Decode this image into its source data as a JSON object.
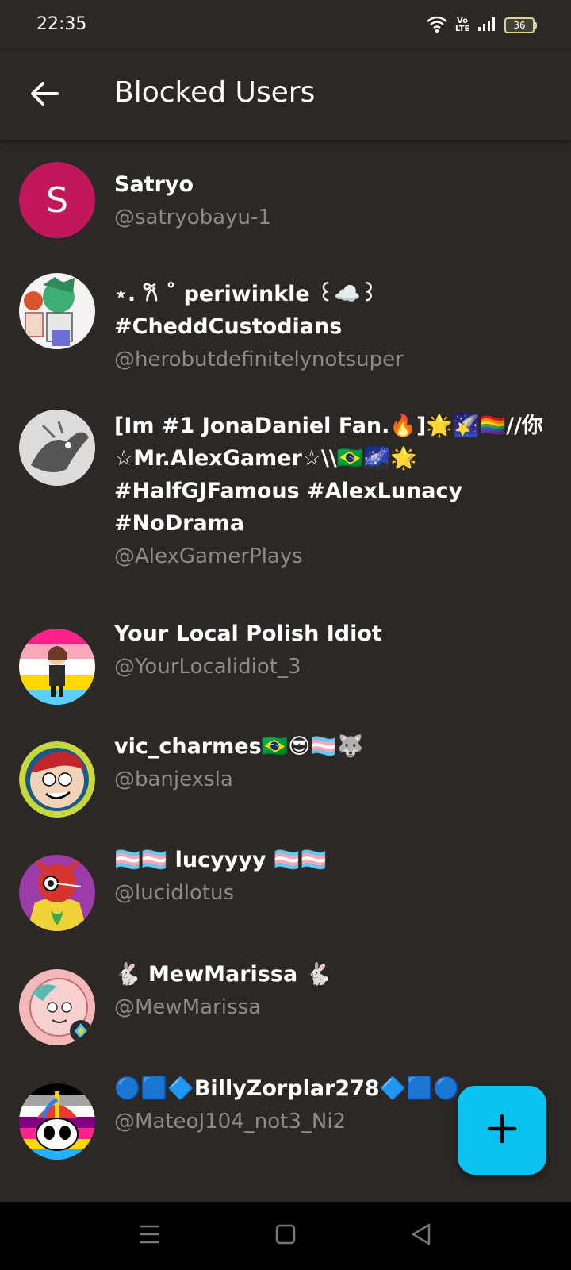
{
  "status_bar": {
    "time": "22:35",
    "network": "Vo LTE",
    "battery": "36"
  },
  "app_bar": {
    "title": "Blocked Users",
    "back_icon": "arrow-left-icon"
  },
  "users": [
    {
      "display_name": "Satryo",
      "handle": "@satryobayu-1",
      "avatar_letter": "S",
      "avatar_color": "#c2185b"
    },
    {
      "display_name": "⋆. 𐙚 ˚ periwinkle ꒰☁️꒱\n#CheddCustodians",
      "handle": "@herobutdefinitelynotsuper"
    },
    {
      "display_name": "[Im #1 JonaDaniel Fan.🔥]🌟🌠🏳️‍🌈//你\n☆Mr.AlexGamer☆\\\\🇧🇷🌌🌟\n#HalfGJFamous #AlexLunacy\n#NoDrama",
      "handle": "@AlexGamerPlays"
    },
    {
      "display_name": "Your Local Polish Idiot",
      "handle": "@YourLocalidiot_3"
    },
    {
      "display_name": "vic_charmes🇧🇷😎🏳️‍⚧️🐺",
      "handle": "@banjexsla"
    },
    {
      "display_name": "🏳️‍⚧️🏳️‍⚧️ lucyyyy 🏳️‍⚧️🏳️‍⚧️",
      "handle": "@lucidlotus"
    },
    {
      "display_name": "🐇 MewMarissa 🐇",
      "handle": "@MewMarissa"
    },
    {
      "display_name": "🔵🟦🔷BillyZorplar278🔷🟦🔵",
      "handle": "@MateoJ104_not3_Ni2"
    }
  ],
  "fab": {
    "icon": "plus-icon",
    "color": "#0ac2f0"
  },
  "nav_bar": {
    "icons": [
      "menu-icon",
      "home-square-icon",
      "back-triangle-icon"
    ]
  }
}
